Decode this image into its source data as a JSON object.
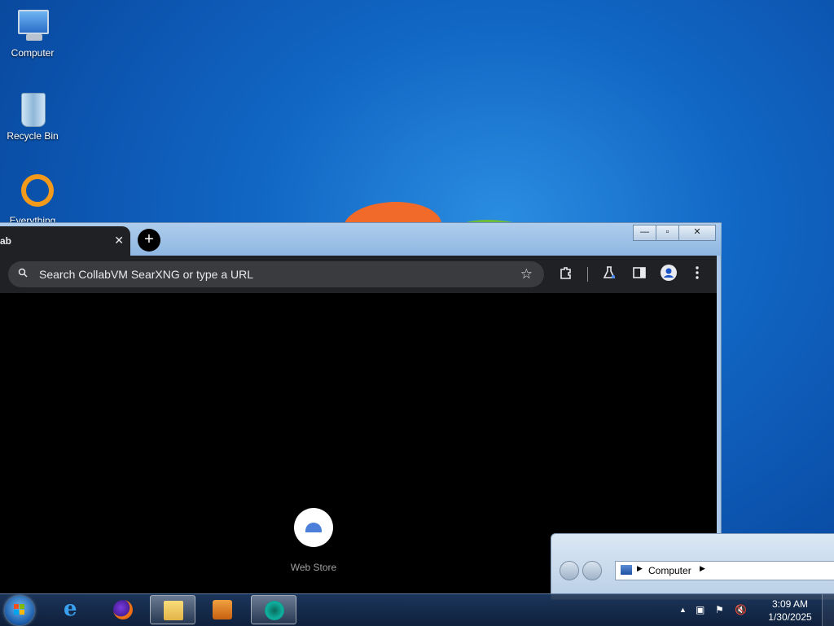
{
  "desktop": {
    "icons": [
      {
        "label": "Computer"
      },
      {
        "label": "Recycle Bin"
      },
      {
        "label": "Everything"
      }
    ]
  },
  "browser": {
    "tab_title": "ab",
    "tab_close": "✕",
    "new_tab": "+",
    "omnibox_placeholder": "Search CollabVM SearXNG or type a URL",
    "star": "☆",
    "caption": {
      "minimize": "—",
      "maximize": "▫",
      "close": "✕"
    },
    "shortcuts": [
      {
        "label": "Web Store"
      }
    ]
  },
  "explorer": {
    "breadcrumb": "Computer"
  },
  "taskbar": {
    "time": "3:09 AM",
    "date": "1/30/2025",
    "tray_expand": "▲"
  },
  "colors": {
    "chrome_dark": "#202124",
    "omnibox": "#3a3b3e",
    "desktop_blue": "#1166c4"
  }
}
